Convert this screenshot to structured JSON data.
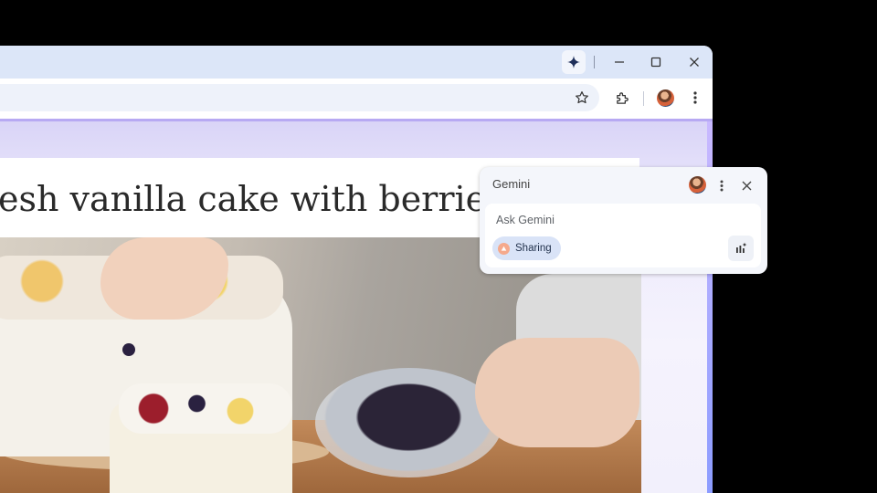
{
  "browser": {
    "titlebar": {
      "icons": [
        "gemini-spark-icon",
        "minimize-icon",
        "maximize-icon",
        "close-icon"
      ]
    },
    "toolbar": {
      "icons": [
        "bookmark-star-icon",
        "extensions-icon",
        "profile-avatar",
        "more-menu-icon"
      ]
    }
  },
  "page": {
    "heading": "esh vanilla cake with berries"
  },
  "gemini_panel": {
    "title": "Gemini",
    "input_placeholder": "Ask Gemini",
    "chip_label": "Sharing",
    "icons": [
      "profile-avatar",
      "more-menu-icon",
      "close-icon",
      "voice-input-icon"
    ]
  },
  "colors": {
    "titlebar": "#dce6f8",
    "accent_purple": "#b7a9f3",
    "chip_bg": "#d9e3f7"
  }
}
